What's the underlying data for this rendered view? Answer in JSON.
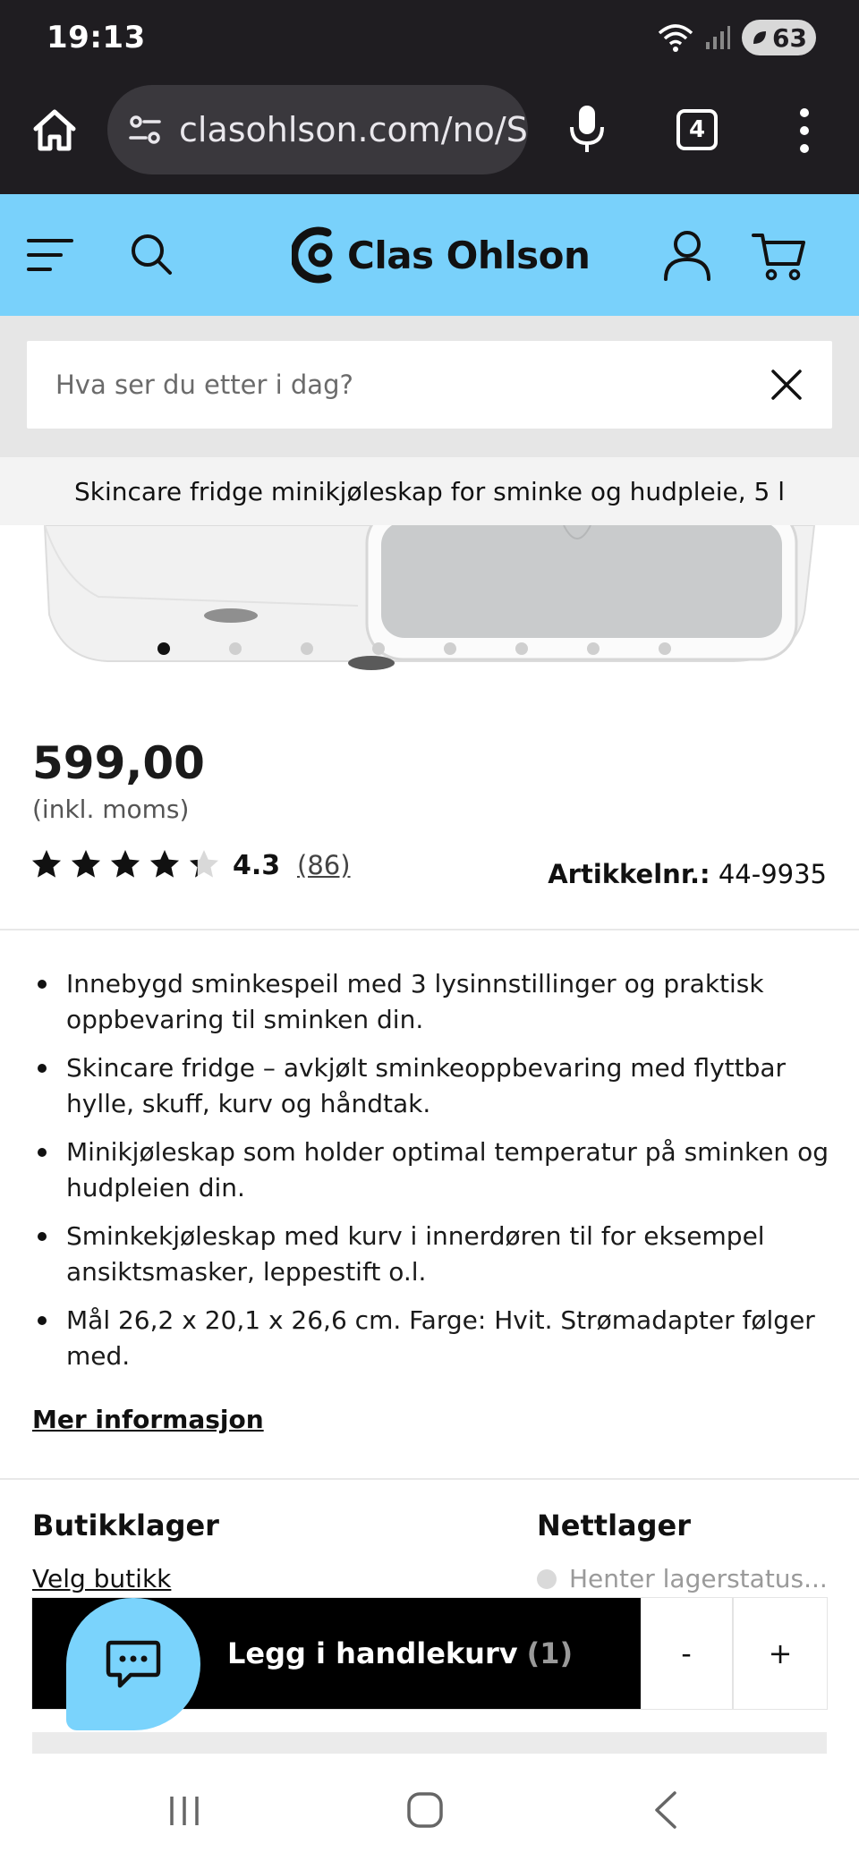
{
  "status_bar": {
    "time": "19:13",
    "battery": "63"
  },
  "browser": {
    "url": "clasohlson.com/no/S",
    "tab_count": "4"
  },
  "header": {
    "logo_text": "Clas Ohlson",
    "accent_color": "#79d1fb"
  },
  "search": {
    "placeholder": "Hva ser du etter i dag?"
  },
  "product": {
    "title": "Skincare fridge minikjøleskap for sminke og hudpleie, 5 l",
    "price": "599,00",
    "vat_note": "(inkl. moms)",
    "rating": "4.3",
    "rating_fraction": 0.86,
    "review_count": "(86)",
    "article_label": "Artikkelnr.:",
    "article_number": "44-9935",
    "image_count": 8,
    "active_image": 1,
    "features": [
      "Innebygd sminkespeil med 3 lysinnstillinger og praktisk oppbevaring til sminken din.",
      "Skincare fridge – avkjølt sminkeoppbevaring med flyttbar hylle, skuff, kurv og håndtak.",
      "Minikjøleskap som holder optimal temperatur på sminken og hudpleien din.",
      "Sminkekjøleskap med kurv i innerdøren til for eksempel ansiktsmasker, leppestift o.l.",
      "Mål 26,2 x 20,1 x 26,6 cm. Farge: Hvit. Strømadapter følger med."
    ],
    "more_info": "Mer informasjon"
  },
  "stock": {
    "store_title": "Butikklager",
    "choose_store": "Velg butikk",
    "online_title": "Nettlager",
    "online_status": "Henter lagerstatus..."
  },
  "cart_bar": {
    "add_label": "Legg i handlekurv",
    "count": "(1)",
    "minus": "-",
    "plus": "+"
  }
}
